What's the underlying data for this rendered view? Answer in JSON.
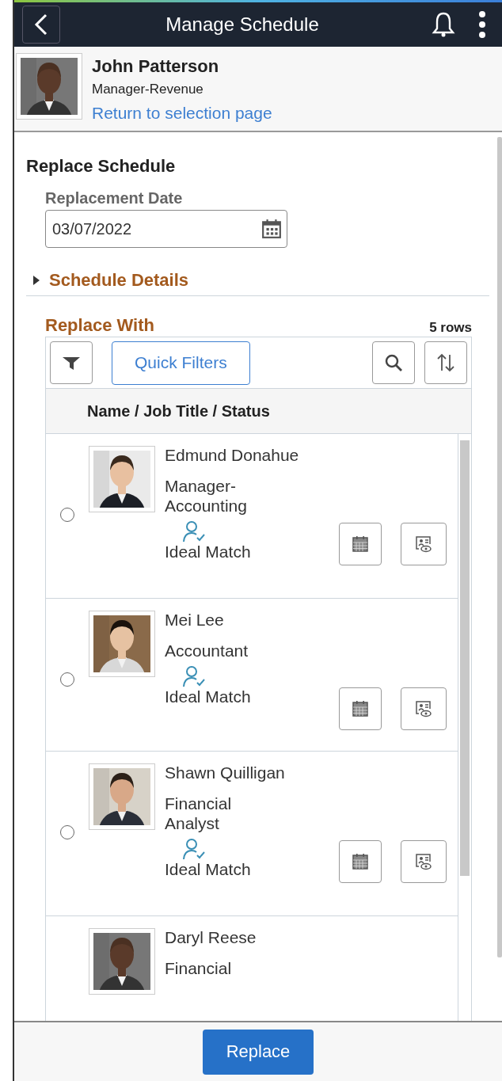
{
  "header": {
    "title": "Manage Schedule"
  },
  "employee": {
    "name": "John Patterson",
    "job": "Manager-Revenue",
    "link": "Return to selection page"
  },
  "section": {
    "title": "Replace Schedule",
    "date_label": "Replacement Date",
    "date_value": "03/07/2022"
  },
  "details": {
    "label": "Schedule Details",
    "expanded": false
  },
  "replace_with": {
    "title": "Replace With",
    "count": "5 rows",
    "quick_filters": "Quick Filters",
    "column": "Name / Job Title / Status",
    "rows": [
      {
        "name": "Edmund Donahue",
        "job": "Manager-\nAccounting",
        "status": "Ideal Match",
        "selected": false
      },
      {
        "name": "Mei Lee",
        "job": "Accountant",
        "status": "Ideal Match",
        "selected": false
      },
      {
        "name": "Shawn Quilligan",
        "job": "Financial\nAnalyst",
        "status": "Ideal Match",
        "selected": false
      },
      {
        "name": "Daryl Reese",
        "job": "Financial"
      }
    ]
  },
  "footer": {
    "button": "Replace"
  }
}
